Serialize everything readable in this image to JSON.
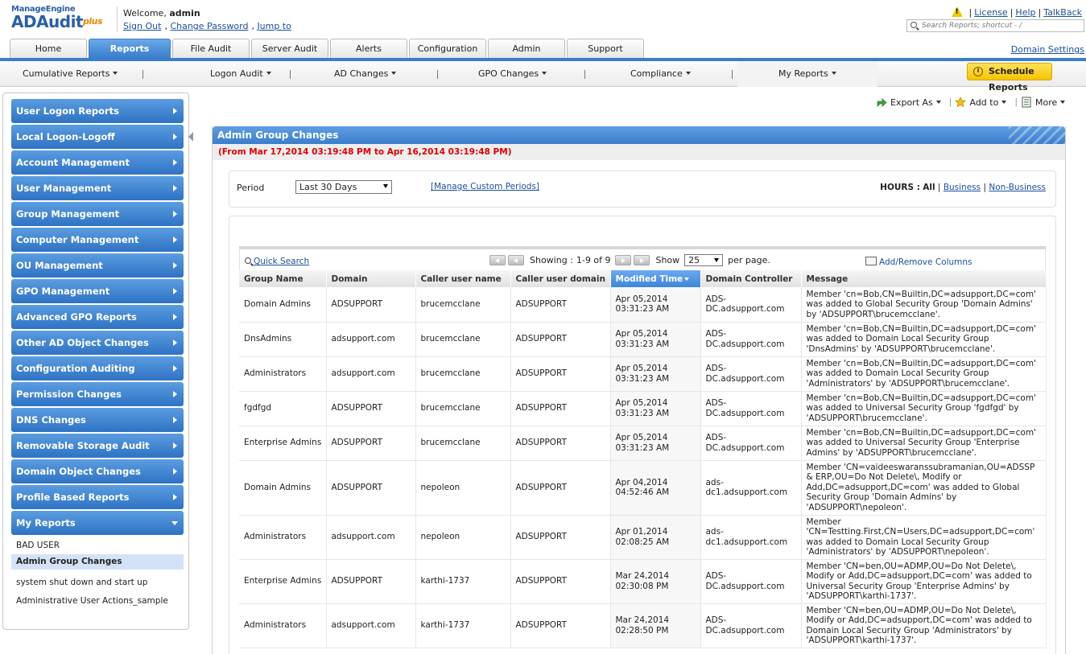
{
  "header": {
    "logo_brand": "ManageEngine",
    "logo_product": "ADAudit",
    "logo_plus": "plus",
    "welcome_prefix": "Welcome,",
    "user": "admin",
    "links": [
      "Sign Out",
      "Change Password",
      "Jump to"
    ],
    "top_links": [
      "License",
      "Help",
      "TalkBack"
    ],
    "search_placeholder": "Search Reports; shortcut - /"
  },
  "tabs": [
    "Home",
    "Reports",
    "File Audit",
    "Server Audit",
    "Alerts",
    "Configuration",
    "Admin",
    "Support"
  ],
  "active_tab": "Reports",
  "domain_settings": "Domain Settings",
  "submenu": [
    "Cumulative Reports",
    "Logon Audit",
    "AD Changes",
    "GPO Changes",
    "Compliance",
    "My Reports"
  ],
  "schedule_reports": "Schedule Reports",
  "sidebar": {
    "sections": [
      "User Logon Reports",
      "Local Logon-Logoff",
      "Account Management",
      "User Management",
      "Group Management",
      "Computer Management",
      "OU Management",
      "GPO Management",
      "Advanced GPO Reports",
      "Other AD Object Changes",
      "Configuration Auditing",
      "Permission Changes",
      "DNS Changes",
      "Removable Storage Audit",
      "Domain Object Changes",
      "Profile Based Reports",
      "My Reports"
    ],
    "my_reports": [
      "BAD USER",
      "Admin Group Changes",
      "system shut down and start up",
      "Administrative User Actions_sample"
    ]
  },
  "toolbar": {
    "export_as": "Export As",
    "add_to": "Add to",
    "more": "More"
  },
  "report": {
    "title": "Admin Group Changes",
    "date_range": "(From Mar 17,2014 03:19:48 PM to Apr 16,2014 03:19:48 PM)",
    "period_label": "Period",
    "period_value": "Last 30 Days",
    "manage_periods": "[Manage Custom Periods]",
    "hours_label": "HOURS :",
    "hours_all": "All",
    "hours_business": "Business",
    "hours_non_business": "Non-Business",
    "quick_search": "Quick Search",
    "showing_label": "Showing :",
    "showing_range": "1-9 of 9",
    "show_label": "Show",
    "page_size": "25",
    "per_page": "per page.",
    "add_remove_columns": "Add/Remove Columns",
    "columns": [
      "Group Name",
      "Domain",
      "Caller user name",
      "Caller user domain",
      "Modified Time",
      "Domain Controller",
      "Message"
    ],
    "rows": [
      [
        "Domain Admins",
        "ADSUPPORT",
        "brucemcclane",
        "ADSUPPORT",
        "Apr 05,2014 03:31:23 AM",
        "ADS-DC.adsupport.com",
        "Member 'cn=Bob,CN=Builtin,DC=adsupport,DC=com' was added to Global Security Group 'Domain Admins' by 'ADSUPPORT\\brucemcclane'."
      ],
      [
        "DnsAdmins",
        "adsupport.com",
        "brucemcclane",
        "ADSUPPORT",
        "Apr 05,2014 03:31:23 AM",
        "ADS-DC.adsupport.com",
        "Member 'cn=Bob,CN=Builtin,DC=adsupport,DC=com' was added to Domain Local Security Group 'DnsAdmins' by 'ADSUPPORT\\brucemcclane'."
      ],
      [
        "Administrators",
        "adsupport.com",
        "brucemcclane",
        "ADSUPPORT",
        "Apr 05,2014 03:31:23 AM",
        "ADS-DC.adsupport.com",
        "Member 'cn=Bob,CN=Builtin,DC=adsupport,DC=com' was added to Domain Local Security Group 'Administrators' by 'ADSUPPORT\\brucemcclane'."
      ],
      [
        "fgdfgd",
        "ADSUPPORT",
        "brucemcclane",
        "ADSUPPORT",
        "Apr 05,2014 03:31:23 AM",
        "ADS-DC.adsupport.com",
        "Member 'cn=Bob,CN=Builtin,DC=adsupport,DC=com' was added to Universal Security Group 'fgdfgd' by 'ADSUPPORT\\brucemcclane'."
      ],
      [
        "Enterprise Admins",
        "ADSUPPORT",
        "brucemcclane",
        "ADSUPPORT",
        "Apr 05,2014 03:31:23 AM",
        "ADS-DC.adsupport.com",
        "Member 'cn=Bob,CN=Builtin,DC=adsupport,DC=com' was added to Universal Security Group 'Enterprise Admins' by 'ADSUPPORT\\brucemcclane'."
      ],
      [
        "Domain Admins",
        "ADSUPPORT",
        "nepoleon",
        "ADSUPPORT",
        "Apr 04,2014 04:52:46 AM",
        "ads-dc1.adsupport.com",
        "Member 'CN=vaideeswaranssubramanian,OU=ADSSP & ERP,OU=Do Not Delete\\, Modify or Add,DC=adsupport,DC=com' was added to Global Security Group 'Domain Admins' by 'ADSUPPORT\\nepoleon'."
      ],
      [
        "Administrators",
        "adsupport.com",
        "nepoleon",
        "ADSUPPORT",
        "Apr 01,2014 02:08:25 AM",
        "ads-dc1.adsupport.com",
        "Member 'CN=Testting.First,CN=Users,DC=adsupport,DC=com' was added to Domain Local Security Group 'Administrators' by 'ADSUPPORT\\nepoleon'."
      ],
      [
        "Enterprise Admins",
        "ADSUPPORT",
        "karthi-1737",
        "ADSUPPORT",
        "Mar 24,2014 02:30:08 PM",
        "ADS-DC.adsupport.com",
        "Member 'CN=ben,OU=ADMP,OU=Do Not Delete\\, Modify or Add,DC=adsupport,DC=com' was added to Universal Security Group 'Enterprise Admins' by 'ADSUPPORT\\karthi-1737'."
      ],
      [
        "Administrators",
        "adsupport.com",
        "karthi-1737",
        "ADSUPPORT",
        "Mar 24,2014 02:28:50 PM",
        "ADS-DC.adsupport.com",
        "Member 'CN=ben,OU=ADMP,OU=Do Not Delete\\, Modify or Add,DC=adsupport,DC=com' was added to Domain Local Security Group 'Administrators' by 'ADSUPPORT\\karthi-1737'."
      ]
    ]
  },
  "colors": {
    "accent_blue": "#3a7dcc",
    "date_red": "#e00000",
    "schedule_yellow": "#f5c400"
  }
}
